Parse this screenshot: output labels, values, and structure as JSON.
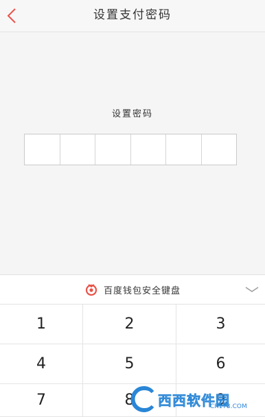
{
  "header": {
    "title": "设置支付密码"
  },
  "main": {
    "prompt": "设置密码",
    "pin_cells": 6
  },
  "keyboard": {
    "title": "百度钱包安全键盘",
    "keys": [
      "1",
      "2",
      "3",
      "4",
      "5",
      "6",
      "7",
      "8",
      "9"
    ]
  },
  "watermark": {
    "text": "西西软件园",
    "sub": "CR173.COM"
  },
  "colors": {
    "accent": "#e8534a",
    "brand_red": "#e8534a",
    "watermark": "#2a86d6"
  }
}
